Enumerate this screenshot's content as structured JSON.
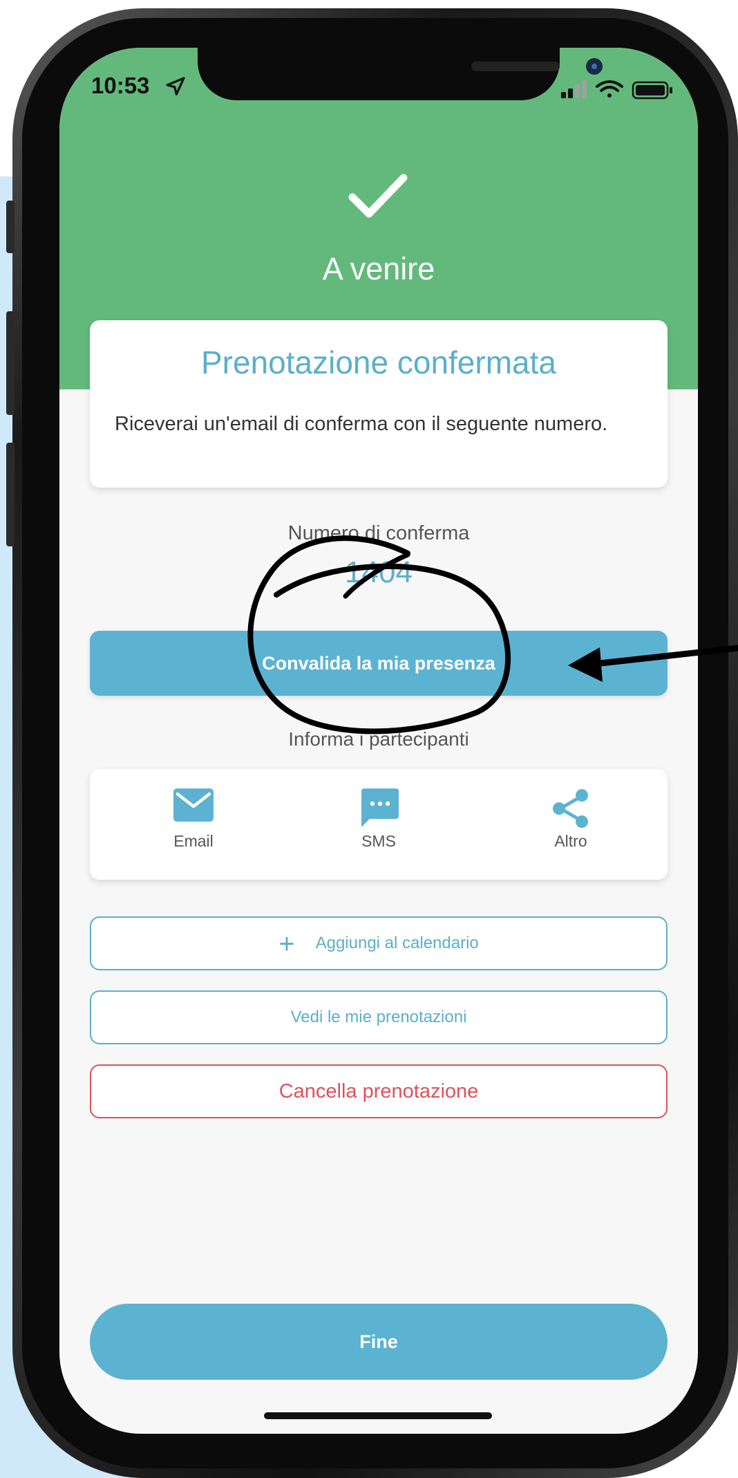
{
  "status_bar": {
    "time": "10:53"
  },
  "hero": {
    "title": "A venire"
  },
  "confirmation_card": {
    "title": "Prenotazione confermata",
    "text": "Riceverai un'email di conferma con il seguente numero."
  },
  "confirmation_number": {
    "label": "Numero di conferma",
    "value": "1404"
  },
  "validate_button": {
    "label": "Convalida la mia presenza"
  },
  "share": {
    "heading": "Informa i partecipanti",
    "items": [
      {
        "label": "Email",
        "icon": "email-icon"
      },
      {
        "label": "SMS",
        "icon": "sms-icon"
      },
      {
        "label": "Altro",
        "icon": "share-icon"
      }
    ]
  },
  "actions": {
    "add_calendar": "Aggiungi al calendario",
    "view_bookings": "Vedi le mie prenotazioni",
    "cancel_booking": "Cancella prenotazione"
  },
  "footer": {
    "done": "Fine"
  },
  "colors": {
    "accent": "#5cb3d1",
    "header_green": "#63b97c",
    "danger": "#e0505a"
  }
}
